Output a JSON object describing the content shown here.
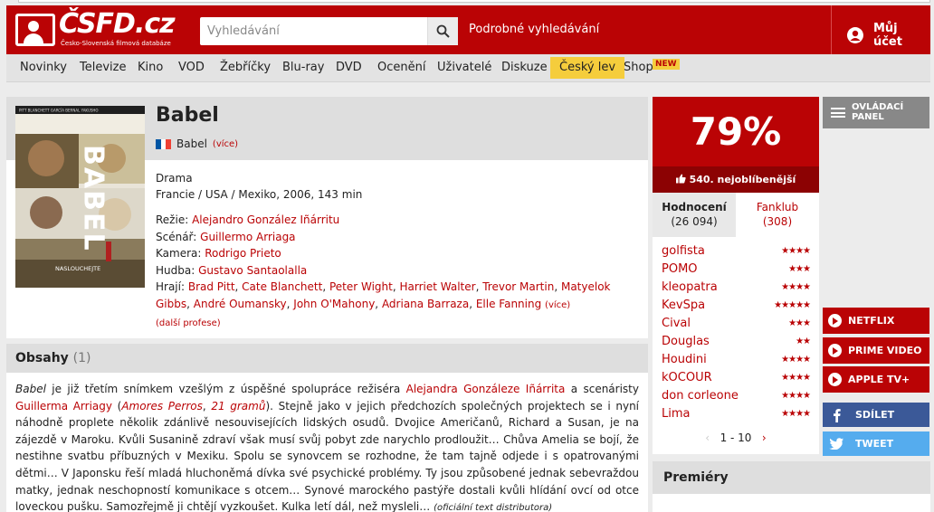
{
  "header": {
    "logo_name": "ČSFD.cz",
    "logo_tagline": "Česko-Slovenská filmová databáze",
    "search_placeholder": "Vyhledávání",
    "advanced_search": "Podrobné vyhledávání",
    "account": "Můj účet"
  },
  "nav": {
    "items": [
      "Novinky",
      "Televize",
      "Kino",
      "VOD",
      "Žebříčky",
      "Blu-ray",
      "DVD",
      "Ocenění",
      "Uživatelé",
      "Diskuze",
      "Český lev",
      "Shop"
    ],
    "badge": "NEW"
  },
  "film": {
    "title": "Babel",
    "original_title": "Babel",
    "more": "(více)",
    "genre": "Drama",
    "origin": "Francie / USA / Mexiko, 2006, 143 min",
    "directing_label": "Režie:",
    "directing": "Alejandro González Iñárritu",
    "screenplay_label": "Scénář:",
    "screenplay": "Guillermo Arriaga",
    "camera_label": "Kamera:",
    "camera": "Rodrigo Prieto",
    "music_label": "Hudba:",
    "music": "Gustavo Santaolalla",
    "cast_label": "Hrají:",
    "cast": [
      "Brad Pitt",
      "Cate Blanchett",
      "Peter Wight",
      "Harriet Walter",
      "Trevor Martin",
      "Matyelok Gibbs",
      "André Oumansky",
      "John O'Mahony",
      "Adriana Barraza",
      "Elle Fanning"
    ],
    "cast_more": "(více)",
    "further_professions": "(další profese)",
    "poster_title": "BABEL",
    "poster_subtitle": "NASLOUCHEJTE",
    "poster_actors": "PITT  BLANCHETT  GARCÍA BERNAL  YAKUSHO"
  },
  "synopsis": {
    "heading": "Obsahy",
    "count": "(1)",
    "intro_italic": "Babel",
    "t1": " je již třetím snímkem vzešlým z úspěšné spolupráce režiséra ",
    "link1": "Alejandra Gonzáleze Iñárrita",
    "t2": " a scenáristy ",
    "link2": "Guillerma Arriagy",
    "t3": " (",
    "link3": "Amores Perros",
    "t4": ", ",
    "link4": "21 gramů",
    "t5": "). Stejně jako v jejich předchozích společných projektech se i nyní náhodně proplete několik zdánlivě nesouvisejících lidských osudů. Dvojice Američanů, Richard a Susan, je na zájezdě v Maroku. Kvůli Susanině zdraví však musí svůj pobyt zde narychlo prodloužit… Chůva Amelia se bojí, že nestihne svatbu příbuzných v Mexiku. Spolu se synovcem se rozhodne, že tam tajně odjede i s opatrovanými dětmi… V Japonsku řeší mladá hluchoněmá dívka své psychické problémy. Ty jsou způsobené jednak sebevraždou matky, jednak neschopností komunikace s otcem… Synové marockého pastýře dostali kvůli hlídání ovcí od otce loveckou pušku. Samozřejmě ji chtějí vyzkoušet. Kulka letí dál, než mysleli… ",
    "source": "(oficiální text distributora)"
  },
  "rating": {
    "percent": "79%",
    "rank": "540. nejoblíbenější",
    "tab_ratings": "Hodnocení",
    "tab_ratings_count": "(26 094)",
    "tab_fanclub": "Fanklub",
    "tab_fanclub_count": "(308)",
    "users": [
      {
        "name": "golfista",
        "stars": 4
      },
      {
        "name": "POMO",
        "stars": 3
      },
      {
        "name": "kleopatra",
        "stars": 4
      },
      {
        "name": "KevSpa",
        "stars": 5
      },
      {
        "name": "Cival",
        "stars": 3
      },
      {
        "name": "Douglas",
        "stars": 2
      },
      {
        "name": "Houdini",
        "stars": 4
      },
      {
        "name": "kOCOUR",
        "stars": 4
      },
      {
        "name": "don corleone",
        "stars": 4
      },
      {
        "name": "Lima",
        "stars": 4
      }
    ],
    "pager": "1 - 10"
  },
  "side": {
    "control_panel": "OVLÁDACÍ PANEL",
    "netflix": "NETFLIX",
    "prime": "PRIME VIDEO",
    "apple": "APPLE TV+",
    "share": "SDÍLET",
    "tweet": "TWEET"
  },
  "premieres": {
    "heading": "Premiéry"
  },
  "colors": {
    "brand": "#ba0305",
    "facebook": "#3b5998",
    "twitter": "#55acee",
    "lev": "#f5cd3c"
  }
}
